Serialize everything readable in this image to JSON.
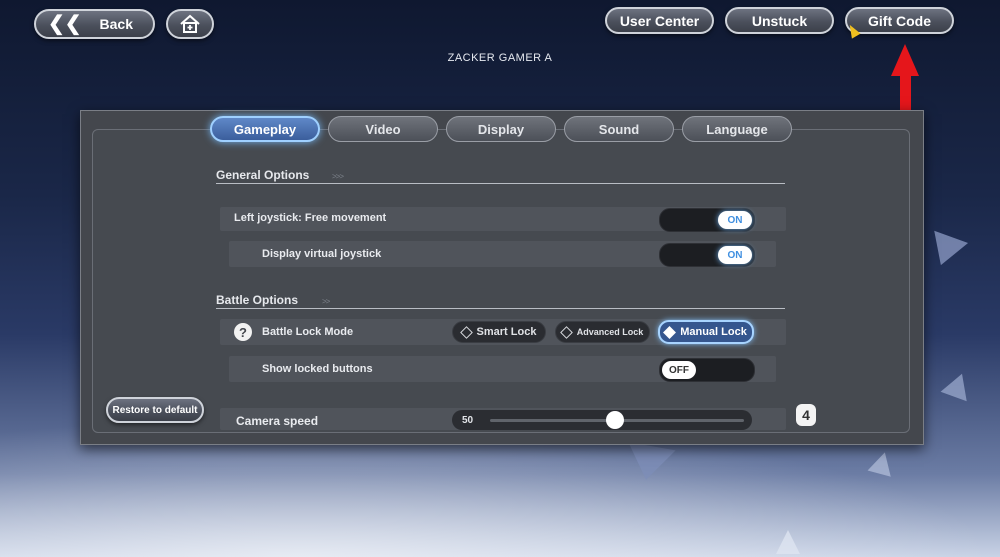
{
  "header": {
    "back_label": "Back",
    "user_center_label": "User Center",
    "unstuck_label": "Unstuck",
    "gift_code_label": "Gift Code",
    "player_name": "ZACKER GAMER A"
  },
  "tabs": [
    {
      "label": "Gameplay",
      "active": true
    },
    {
      "label": "Video",
      "active": false
    },
    {
      "label": "Display",
      "active": false
    },
    {
      "label": "Sound",
      "active": false
    },
    {
      "label": "Language",
      "active": false
    }
  ],
  "general_options": {
    "title": "General Options",
    "left_joystick": {
      "label": "Left joystick: Free movement",
      "state": "ON"
    },
    "virtual_joystick": {
      "label": "Display virtual joystick",
      "state": "ON"
    }
  },
  "battle_options": {
    "title": "Battle Options",
    "lock_mode": {
      "label": "Battle Lock Mode",
      "options": [
        "Smart Lock",
        "Advanced Lock",
        "Manual Lock"
      ],
      "selected": "Manual Lock"
    },
    "show_locked": {
      "label": "Show locked buttons",
      "state": "OFF"
    }
  },
  "camera": {
    "label": "Camera speed",
    "value": "50",
    "fraction": 0.5
  },
  "restore_label": "Restore to default",
  "badge_number": "4",
  "colors": {
    "accent": "#5f88c8",
    "highlight": "#9fd0ff",
    "annotation_arrow": "#e5161b"
  }
}
